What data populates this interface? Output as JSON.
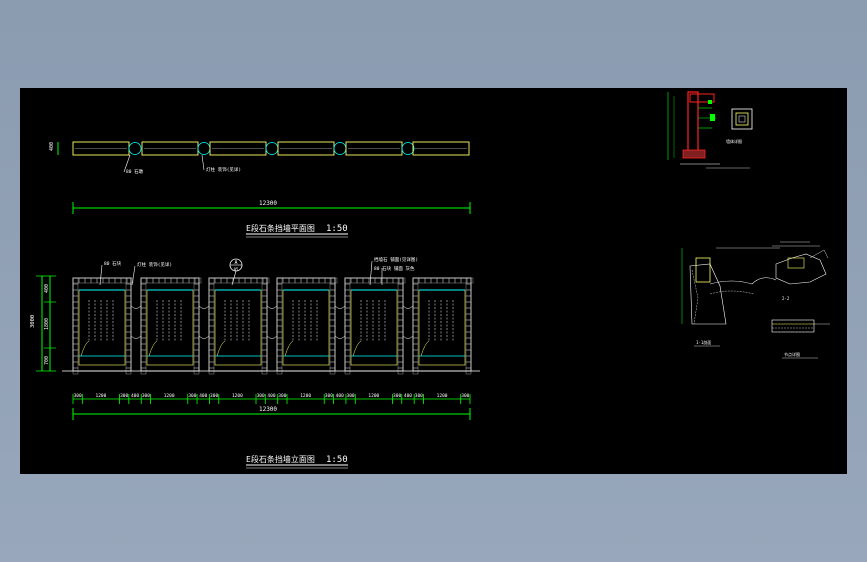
{
  "drawing": {
    "plan": {
      "dimension_total": "12300",
      "dimension_height": "400",
      "title": "E段石条挡墙平面图",
      "scale": "1:50",
      "callouts": [
        "80 石墩",
        "灯柱 装饰(见详)"
      ]
    },
    "elevation": {
      "title": "E段石条挡墙立面图",
      "scale": "1:50",
      "dimension_total": "12300",
      "dims_left": [
        "3000",
        "400",
        "1800",
        "700"
      ],
      "dims_bottom": [
        "300",
        "1200",
        "300",
        "400",
        "300",
        "1200",
        "300",
        "400",
        "300",
        "1200",
        "300",
        "400",
        "300",
        "1200",
        "300",
        "400",
        "300",
        "1200",
        "300",
        "400",
        "300",
        "1200",
        "300"
      ],
      "section_mark_top": "A",
      "section_mark_bottom": "05",
      "callouts": [
        "80 石块",
        "灯柱 装饰(见详)",
        "挡墙石 铺面(见详图)",
        "80 石块 铺面 灰色"
      ]
    },
    "details": {
      "labels": [
        "墙体详图",
        "1-1剖面",
        "2-2",
        "节点详图"
      ]
    },
    "colors": {
      "background": "#000000",
      "panel": "#ffff66",
      "stone": "#d8d8d8",
      "cyan": "#00ffff",
      "green": "#00ff00",
      "red": "#ff2222",
      "text": "#ffffff"
    }
  }
}
